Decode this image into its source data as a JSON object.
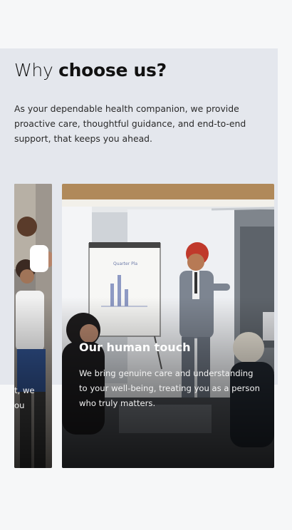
{
  "section": {
    "title_regular": "Why ",
    "title_bold": "choose us?",
    "description": "As your dependable health companion, we provide proactive care, thoughtful guidance, and end-to-end support, that keeps you ahead."
  },
  "cards": {
    "previous": {
      "text_line1": "t, we",
      "text_line2": "ou"
    },
    "current": {
      "title": "Our human touch",
      "text": "We bring genuine care and understanding to your well-being, treating you as a person who truly matters.",
      "flipchart_label": "Quarter Pla"
    }
  }
}
